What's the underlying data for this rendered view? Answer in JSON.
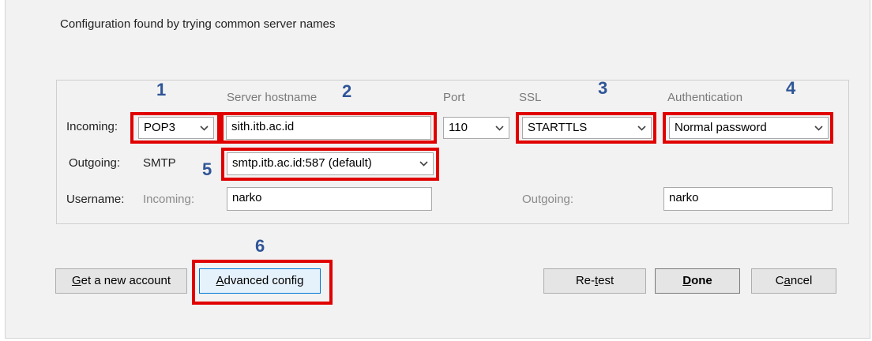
{
  "title": "Configuration found by trying common server names",
  "headers": {
    "server_hostname": "Server hostname",
    "port": "Port",
    "ssl": "SSL",
    "authentication": "Authentication"
  },
  "incoming": {
    "label": "Incoming:",
    "protocol": "POP3",
    "hostname": "sith.itb.ac.id",
    "port": "110",
    "ssl": "STARTTLS",
    "authentication": "Normal password"
  },
  "outgoing": {
    "label": "Outgoing:",
    "protocol": "SMTP",
    "server": "smtp.itb.ac.id:587 (default)"
  },
  "username": {
    "label": "Username:",
    "incoming_label": "Incoming:",
    "incoming_value": "narko",
    "outgoing_label": "Outgoing:",
    "outgoing_value": "narko"
  },
  "annotations": [
    "1",
    "2",
    "3",
    "4",
    "5",
    "6"
  ],
  "buttons": {
    "get_new_account": {
      "underline": "G",
      "rest": "et a new account"
    },
    "advanced_config": {
      "underline": "A",
      "rest": "dvanced config"
    },
    "retest": {
      "pre": "Re-",
      "underline": "t",
      "rest": "est"
    },
    "done": {
      "underline": "D",
      "rest": "one"
    },
    "cancel": {
      "pre": "C",
      "underline": "a",
      "rest": "ncel"
    }
  },
  "colors": {
    "highlight": "#e00000",
    "annotation": "#2f5597",
    "dialog_bg": "#f2f2f2"
  },
  "icons": {
    "dropdown": "chevron-down-icon"
  }
}
